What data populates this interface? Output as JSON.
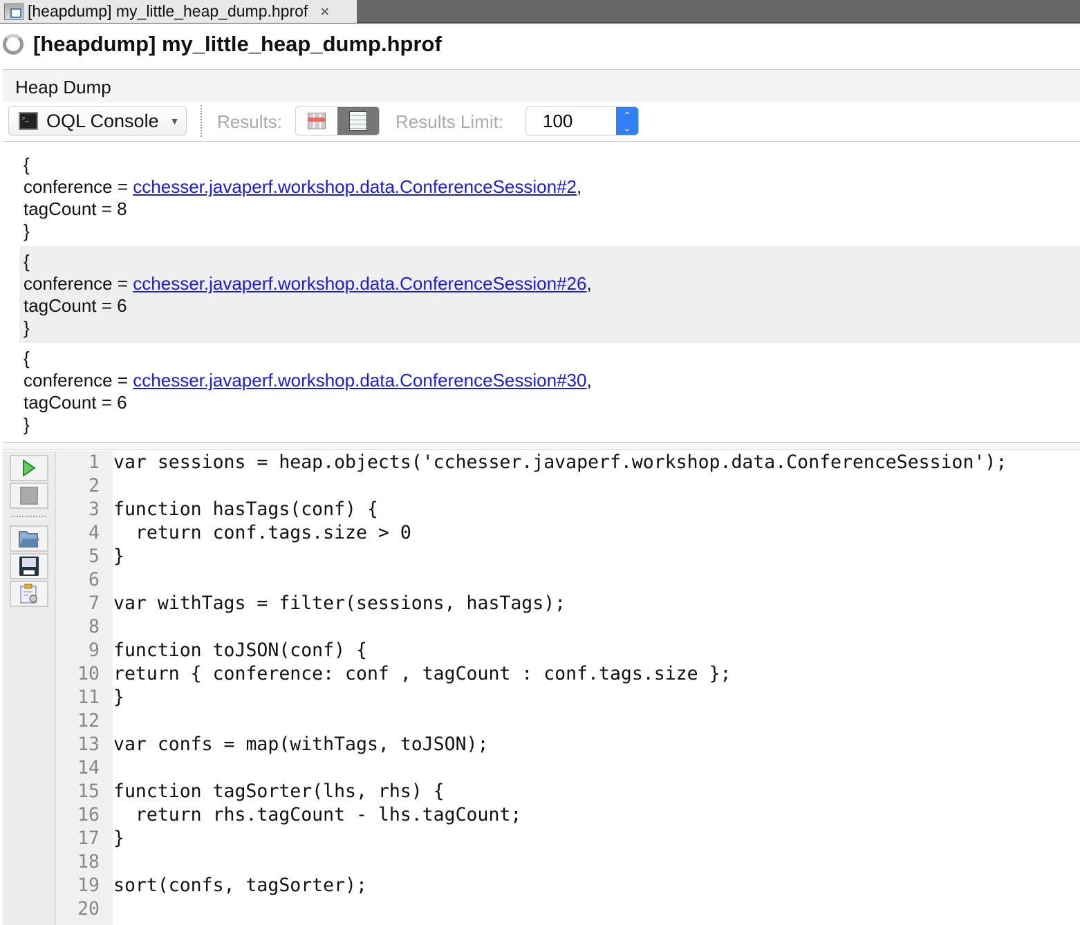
{
  "tab": {
    "label": "[heapdump] my_little_heap_dump.hprof",
    "close": "×"
  },
  "title": "[heapdump] my_little_heap_dump.hprof",
  "section": "Heap Dump",
  "toolbar": {
    "oql_console": "OQL Console",
    "results_label": "Results:",
    "results_limit_label": "Results Limit:",
    "results_limit_value": "100"
  },
  "results": [
    {
      "open": "{",
      "conference_key": "conference = ",
      "conference_link": "cchesser.javaperf.workshop.data.ConferenceSession#2",
      "comma": ",",
      "tagcount": "tagCount = 8",
      "close": "}"
    },
    {
      "open": "{",
      "conference_key": "conference = ",
      "conference_link": "cchesser.javaperf.workshop.data.ConferenceSession#26",
      "comma": ",",
      "tagcount": "tagCount = 6",
      "close": "}"
    },
    {
      "open": "{",
      "conference_key": "conference = ",
      "conference_link": "cchesser.javaperf.workshop.data.ConferenceSession#30",
      "comma": ",",
      "tagcount": "tagCount = 6",
      "close": "}"
    }
  ],
  "code": [
    "var sessions = heap.objects('cchesser.javaperf.workshop.data.ConferenceSession');",
    "",
    "function hasTags(conf) {",
    "  return conf.tags.size > 0",
    "}",
    "",
    "var withTags = filter(sessions, hasTags);",
    "",
    "function toJSON(conf) {",
    "return { conference: conf , tagCount : conf.tags.size };",
    "}",
    "",
    "var confs = map(withTags, toJSON);",
    "",
    "function tagSorter(lhs, rhs) {",
    "  return rhs.tagCount - lhs.tagCount;",
    "}",
    "",
    "sort(confs, tagSorter);",
    ""
  ]
}
